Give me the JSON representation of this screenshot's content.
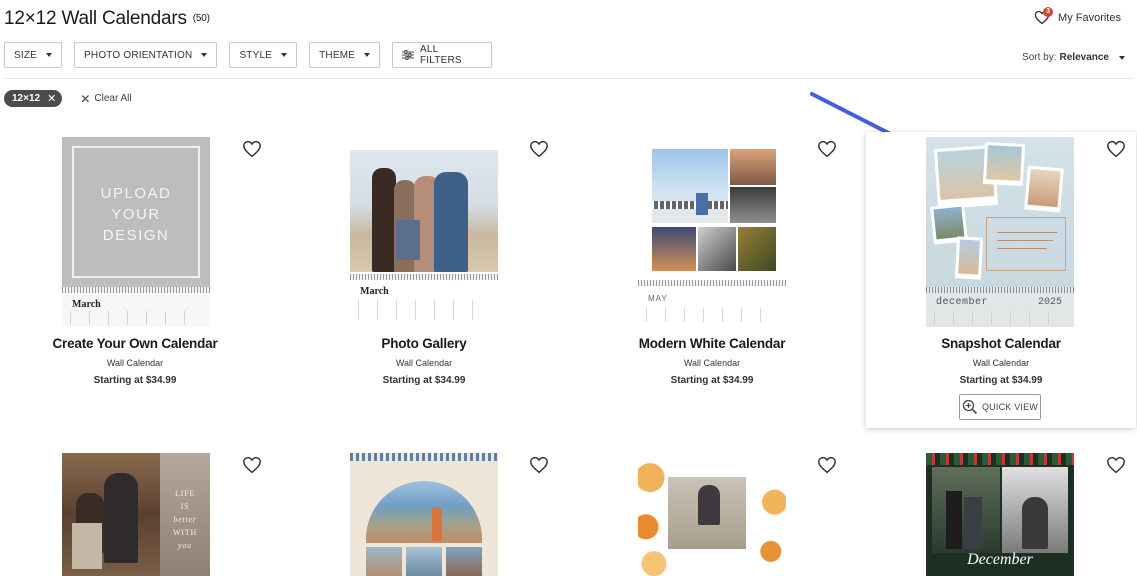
{
  "header": {
    "title": "12×12 Wall Calendars",
    "count": "(50)",
    "favorites_label": "My Favorites",
    "favorites_count": "3"
  },
  "filters": {
    "size": "SIZE",
    "photo_orientation": "PHOTO ORIENTATION",
    "style": "STYLE",
    "theme": "THEME",
    "all_filters": "ALL FILTERS"
  },
  "sort": {
    "label": "Sort by:",
    "value": "Relevance"
  },
  "active_filters": {
    "chip": "12×12",
    "clear_all": "Clear All"
  },
  "products": [
    {
      "name": "Create Your Own Calendar",
      "type": "Wall Calendar",
      "price": "Starting at $34.99",
      "thumb_text_1": "UPLOAD",
      "thumb_text_2": "YOUR",
      "thumb_text_3": "DESIGN",
      "month": "March"
    },
    {
      "name": "Photo Gallery",
      "type": "Wall Calendar",
      "price": "Starting at $34.99",
      "month": "March"
    },
    {
      "name": "Modern White Calendar",
      "type": "Wall Calendar",
      "price": "Starting at $34.99",
      "month": "MAY"
    },
    {
      "name": "Snapshot Calendar",
      "type": "Wall Calendar",
      "price": "Starting at $34.99",
      "month": "december",
      "year": "2025",
      "quick_view": "QUICK VIEW"
    }
  ],
  "second_row": {
    "card5_text_1": "LIFE",
    "card5_text_2": "IS",
    "card5_text_3": "better",
    "card5_text_4": "WITH",
    "card5_text_5": "you",
    "card8_month": "December"
  },
  "colors": {
    "accent_arrow": "#3f5fe0",
    "badge": "#d9432f",
    "chip_bg": "#4c4c4c"
  }
}
